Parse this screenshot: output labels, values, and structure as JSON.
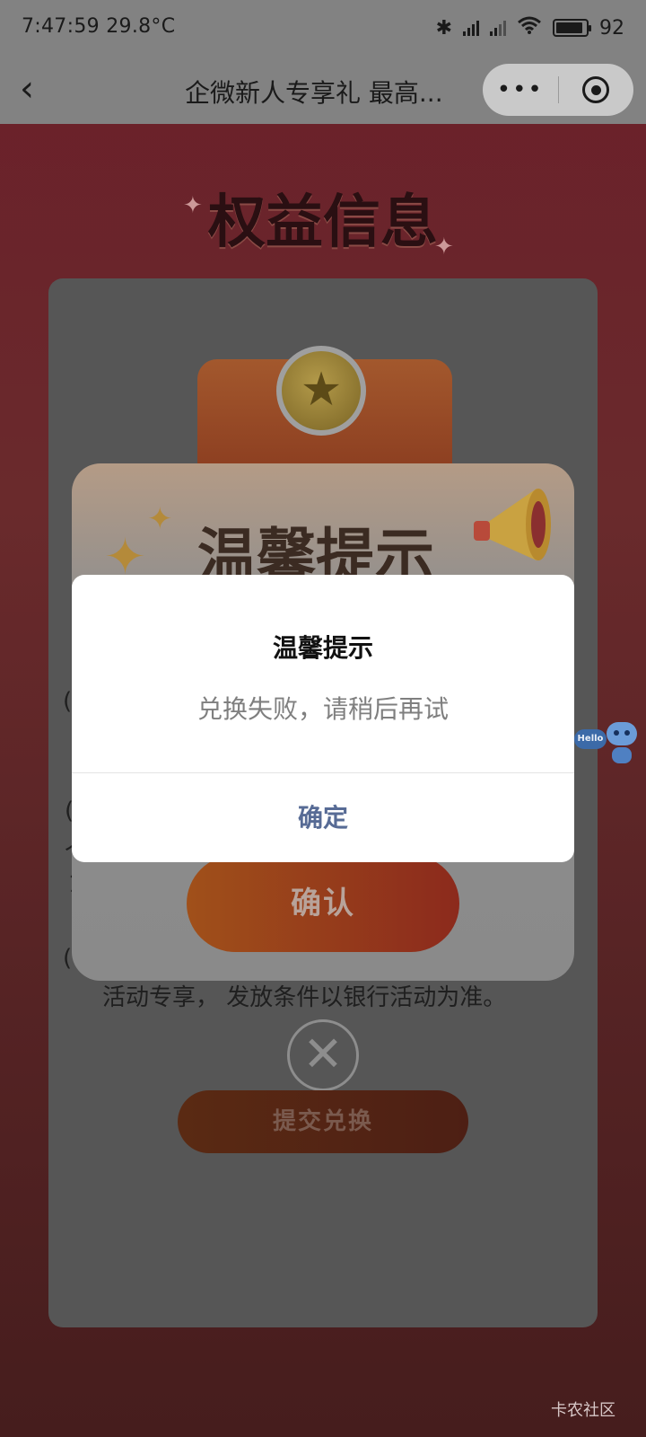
{
  "status_bar": {
    "time": "7:47:59",
    "temperature": "29.8°C",
    "bluetooth_icon": "bluetooth-icon",
    "battery_level": "92",
    "battery_fill": 0.92
  },
  "nav_bar": {
    "title": "企微新人专享礼 最高...",
    "more_label": "•••"
  },
  "background": {
    "page_title": "权益信息",
    "paren_left_1": "(",
    "paren_left_2": "(",
    "paren_left_3": "(",
    "partial_text_1": "个",
    "partial_text_2": "1",
    "condition_text": "活动专享， 发放条件以银行活动为准。",
    "close_symbol": "✕",
    "submit_label": "提交兑换"
  },
  "mid_popup": {
    "title": "温馨提示",
    "confirm_label": "确认"
  },
  "assistant": {
    "hello_label": "Hello"
  },
  "dialog": {
    "title": "温馨提示",
    "message": "兑换失败，请稍后再试",
    "button_label": "确定"
  },
  "watermark": "卡农社区",
  "colors": {
    "dialog_button": "#576b95",
    "status_bar_bg": "#828282",
    "page_bg": "#6b1f2a"
  }
}
